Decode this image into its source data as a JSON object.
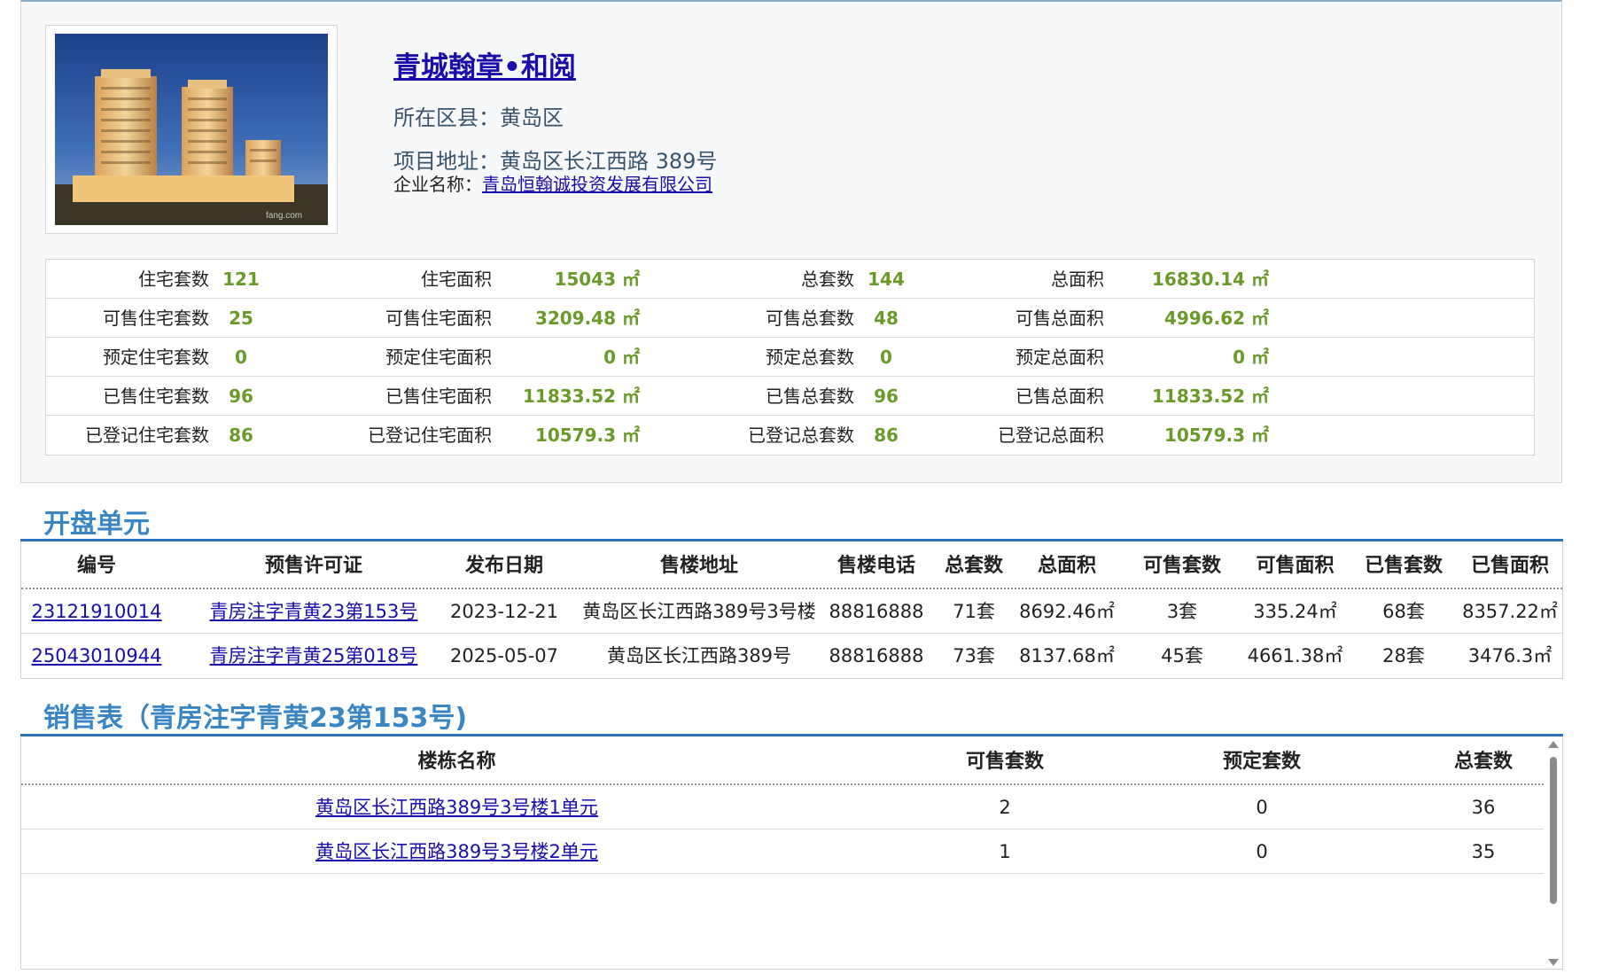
{
  "project": {
    "title": "青城翰章•和阅",
    "district_line": "所在区县：黄岛区",
    "address_line": "项目地址：黄岛区长江西路 389号",
    "company_label": "企业名称：",
    "company_name": "青岛恒翰诚投资发展有限公司",
    "photo_watermark": "fang.com"
  },
  "stats": {
    "rows": [
      {
        "l1": "住宅套数",
        "v1": "121",
        "l2": "住宅面积",
        "v2": "15043 ㎡",
        "l3": "总套数",
        "v3": "144",
        "l4": "总面积",
        "v4": "16830.14 ㎡"
      },
      {
        "l1": "可售住宅套数",
        "v1": "25",
        "l2": "可售住宅面积",
        "v2": "3209.48 ㎡",
        "l3": "可售总套数",
        "v3": "48",
        "l4": "可售总面积",
        "v4": "4996.62 ㎡"
      },
      {
        "l1": "预定住宅套数",
        "v1": "0",
        "l2": "预定住宅面积",
        "v2": "0 ㎡",
        "l3": "预定总套数",
        "v3": "0",
        "l4": "预定总面积",
        "v4": "0 ㎡"
      },
      {
        "l1": "已售住宅套数",
        "v1": "96",
        "l2": "已售住宅面积",
        "v2": "11833.52 ㎡",
        "l3": "已售总套数",
        "v3": "96",
        "l4": "已售总面积",
        "v4": "11833.52 ㎡"
      },
      {
        "l1": "已登记住宅套数",
        "v1": "86",
        "l2": "已登记住宅面积",
        "v2": "10579.3 ㎡",
        "l3": "已登记总套数",
        "v3": "86",
        "l4": "已登记总面积",
        "v4": "10579.3 ㎡"
      }
    ]
  },
  "units": {
    "title": "开盘单元",
    "headers": [
      "编号",
      "预售许可证",
      "发布日期",
      "售楼地址",
      "售楼电话",
      "总套数",
      "总面积",
      "可售套数",
      "可售面积",
      "已售套数",
      "已售面积"
    ],
    "rows": [
      [
        "23121910014",
        "青房注字青黄23第153号",
        "2023-12-21",
        "黄岛区长江西路389号3号楼",
        "88816888",
        "71套",
        "8692.46㎡",
        "3套",
        "335.24㎡",
        "68套",
        "8357.22㎡"
      ],
      [
        "25043010944",
        "青房注字青黄25第018号",
        "2025-05-07",
        "黄岛区长江西路389号",
        "88816888",
        "73套",
        "8137.68㎡",
        "45套",
        "4661.38㎡",
        "28套",
        "3476.3㎡"
      ]
    ]
  },
  "sales": {
    "title": "销售表（青房注字青黄23第153号)",
    "headers": [
      "楼栋名称",
      "可售套数",
      "预定套数",
      "总套数"
    ],
    "rows": [
      [
        "黄岛区长江西路389号3号楼1单元",
        "2",
        "0",
        "36"
      ],
      [
        "黄岛区长江西路389号3号楼2单元",
        "1",
        "0",
        "35"
      ]
    ]
  },
  "colors": {
    "accent": "#3a86c4",
    "rule": "#2a73bb",
    "value_green": "#6a9a2a",
    "link": "#1a0dab"
  }
}
